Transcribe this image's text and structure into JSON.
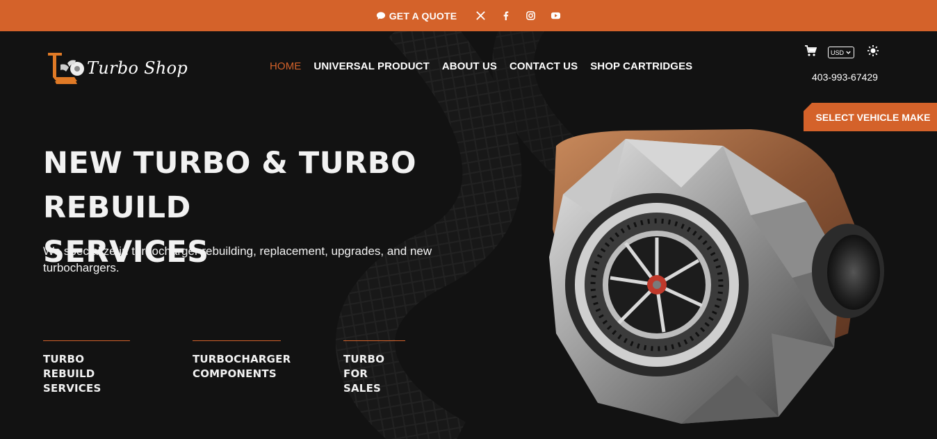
{
  "topbar": {
    "quote_label": "GET A QUOTE",
    "social": [
      "x-icon",
      "facebook-icon",
      "instagram-icon",
      "youtube-icon"
    ]
  },
  "header": {
    "logo_text": "Turbo Shop",
    "nav": [
      {
        "label": "HOME",
        "active": true
      },
      {
        "label": "UNIVERSAL PRODUCT"
      },
      {
        "label": "ABOUT US"
      },
      {
        "label": "CONTACT US"
      },
      {
        "label": "SHOP CARTRIDGES"
      }
    ],
    "currency": "USD",
    "phone": "403-993-67429"
  },
  "vehicle_button": "SELECT VEHICLE MAKE",
  "hero": {
    "title_line1": "NEW TURBO & TURBO REBUILD",
    "title_line2": "SERVICES",
    "subtitle": "We specialize in turbocharger rebuilding, replacement, upgrades, and new turbochargers."
  },
  "features": [
    {
      "line1": "TURBO REBUILD",
      "line2": "SERVICES"
    },
    {
      "line1": "TURBOCHARGER",
      "line2": "COMPONENTS"
    },
    {
      "line1": "TURBO FOR",
      "line2": "SALES"
    }
  ],
  "colors": {
    "accent": "#d4622a",
    "background": "#121212"
  }
}
